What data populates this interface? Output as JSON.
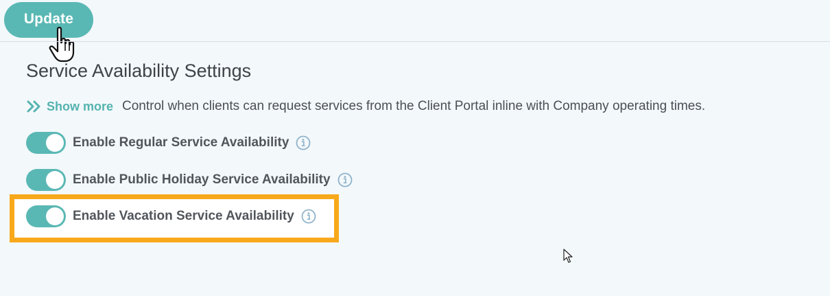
{
  "toolbar": {
    "update_label": "Update"
  },
  "section": {
    "title": "Service Availability Settings",
    "show_more_label": "Show more",
    "description": "Control when clients can request services from the Client Portal inline with Company operating times."
  },
  "settings": [
    {
      "label": "Enable Regular Service Availability",
      "enabled": true
    },
    {
      "label": "Enable Public Holiday Service Availability",
      "enabled": true
    },
    {
      "label": "Enable Vacation Service Availability",
      "enabled": true,
      "highlighted": true
    }
  ],
  "colors": {
    "accent": "#5ab8b4",
    "highlight": "#f7a81b",
    "info_icon": "#8fb3c9",
    "background": "#f3f8fb"
  },
  "icons": {
    "show_more": "double-chevron-right-icon",
    "info": "info-icon",
    "hand_cursor": "hand-pointer-icon",
    "arrow_cursor": "arrow-pointer-icon"
  }
}
